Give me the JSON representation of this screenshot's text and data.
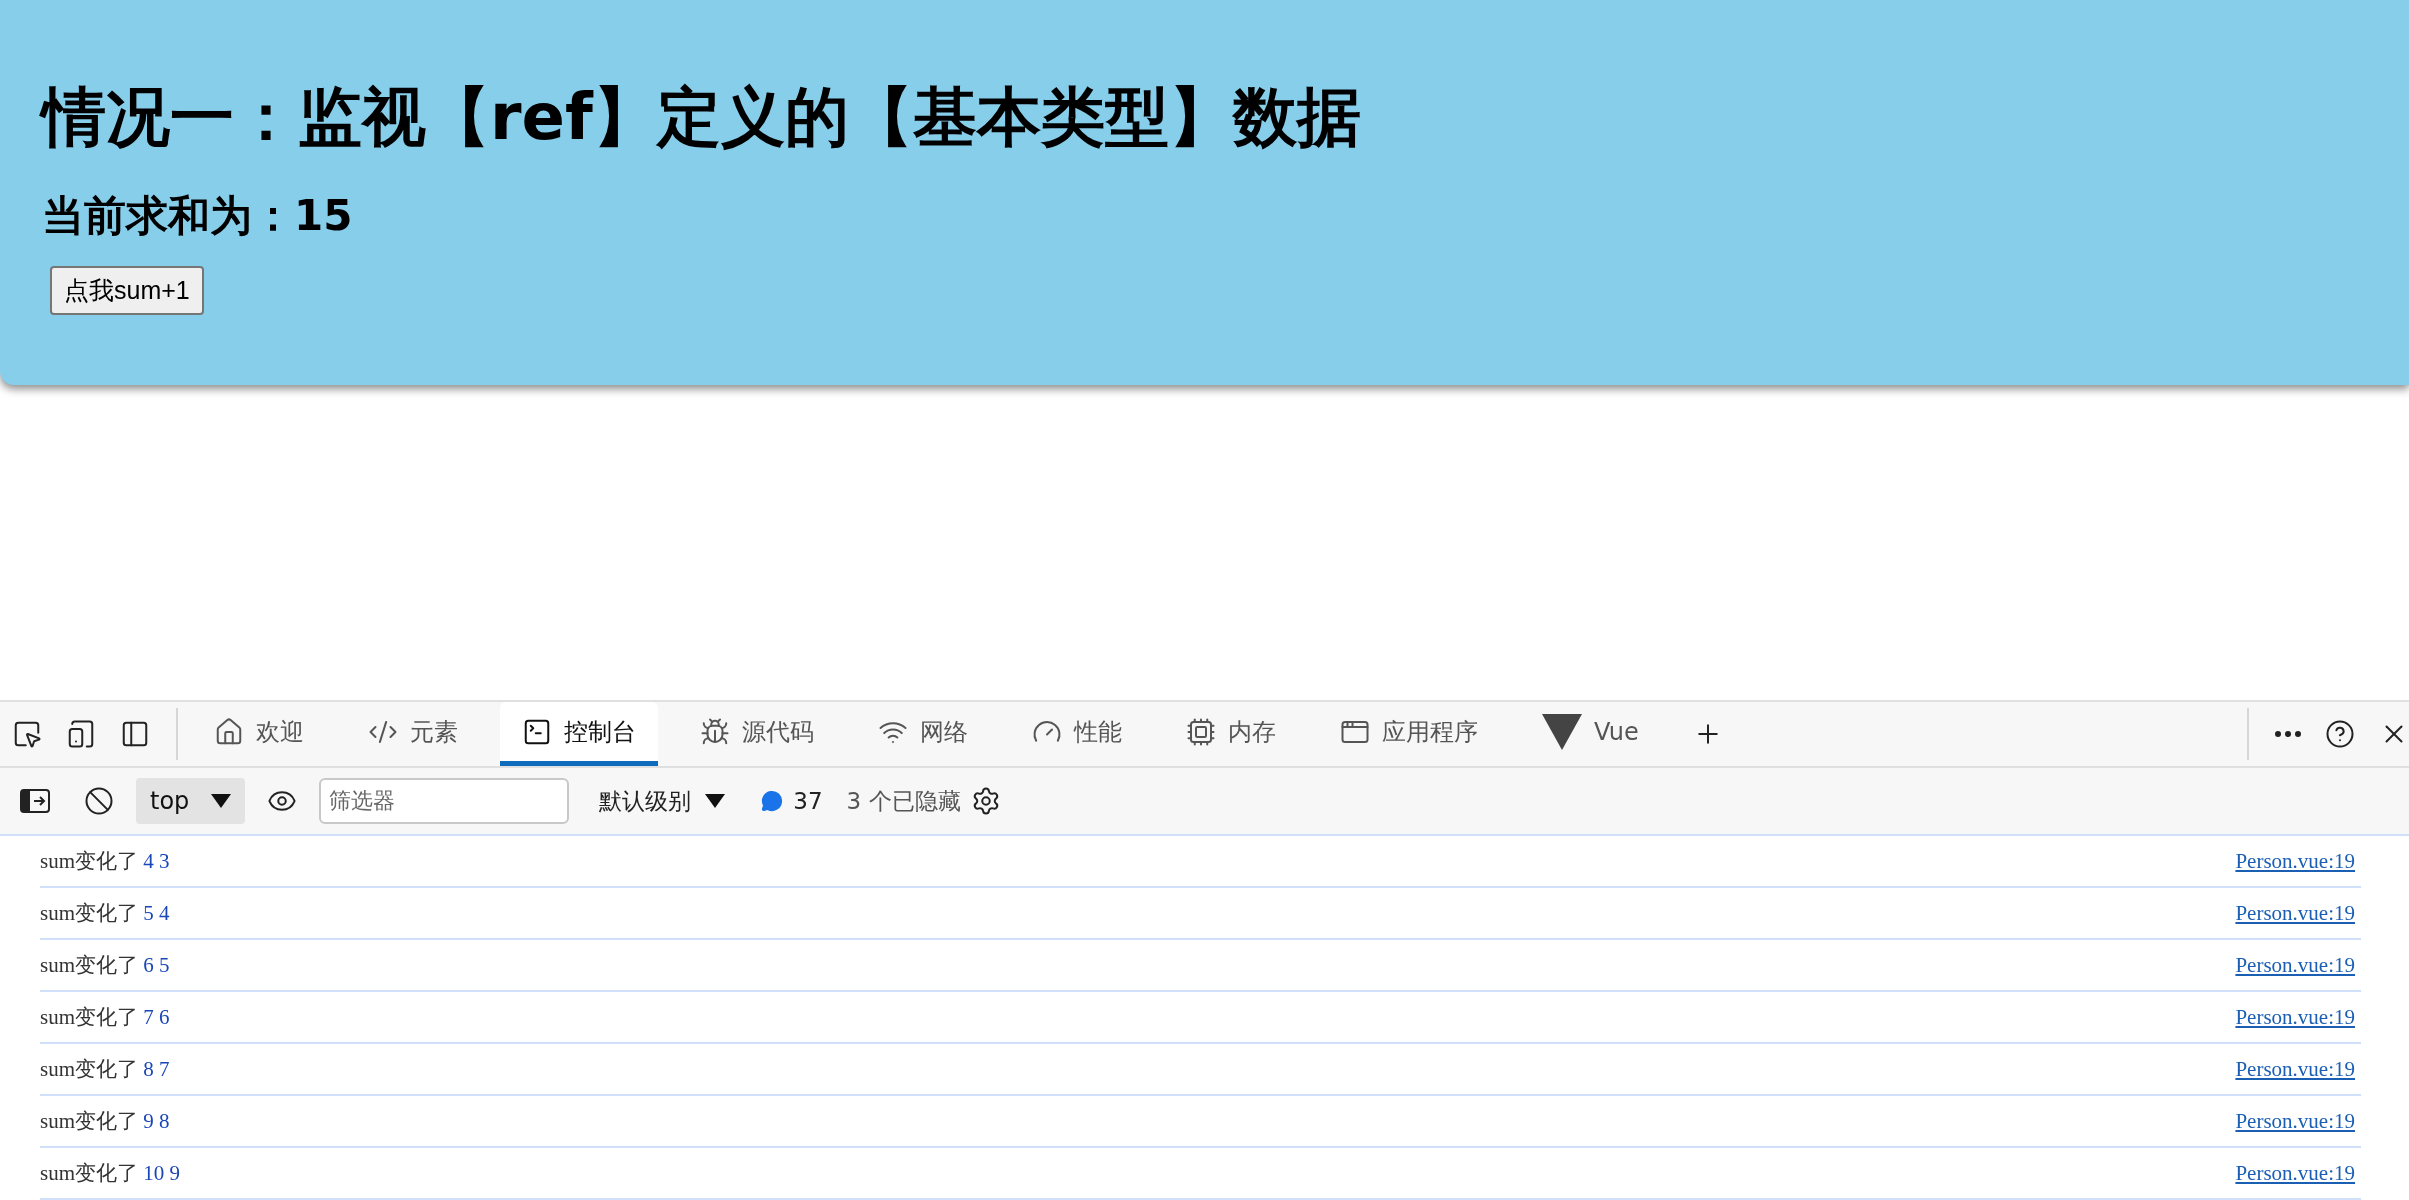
{
  "page": {
    "title": "情况一：监视【ref】定义的【基本类型】数据",
    "sum_label": "当前求和为：15",
    "button": "点我sum+1"
  },
  "devtools": {
    "tabs": [
      {
        "kind": "home",
        "label": "欢迎",
        "selected": false
      },
      {
        "kind": "code",
        "label": "元素",
        "selected": false
      },
      {
        "kind": "console",
        "label": "控制台",
        "selected": true
      },
      {
        "kind": "bug",
        "label": "源代码",
        "selected": false
      },
      {
        "kind": "wifi",
        "label": "网络",
        "selected": false
      },
      {
        "kind": "gauge",
        "label": "性能",
        "selected": false
      },
      {
        "kind": "chip",
        "label": "内存",
        "selected": false
      },
      {
        "kind": "window",
        "label": "应用程序",
        "selected": false
      },
      {
        "kind": "vue",
        "label": "Vue",
        "selected": false
      }
    ],
    "toolbar": {
      "context": "top",
      "filter_placeholder": "筛选器",
      "level": "默认级别",
      "message_count": "37",
      "hidden": "3 个已隐藏"
    },
    "console": [
      {
        "message": "sum变化了",
        "values": "4 3",
        "source": "Person.vue:19"
      },
      {
        "message": "sum变化了",
        "values": "5 4",
        "source": "Person.vue:19"
      },
      {
        "message": "sum变化了",
        "values": "6 5",
        "source": "Person.vue:19"
      },
      {
        "message": "sum变化了",
        "values": "7 6",
        "source": "Person.vue:19"
      },
      {
        "message": "sum变化了",
        "values": "8 7",
        "source": "Person.vue:19"
      },
      {
        "message": "sum变化了",
        "values": "9 8",
        "source": "Person.vue:19"
      },
      {
        "message": "sum变化了",
        "values": "10 9",
        "source": "Person.vue:19"
      }
    ]
  }
}
